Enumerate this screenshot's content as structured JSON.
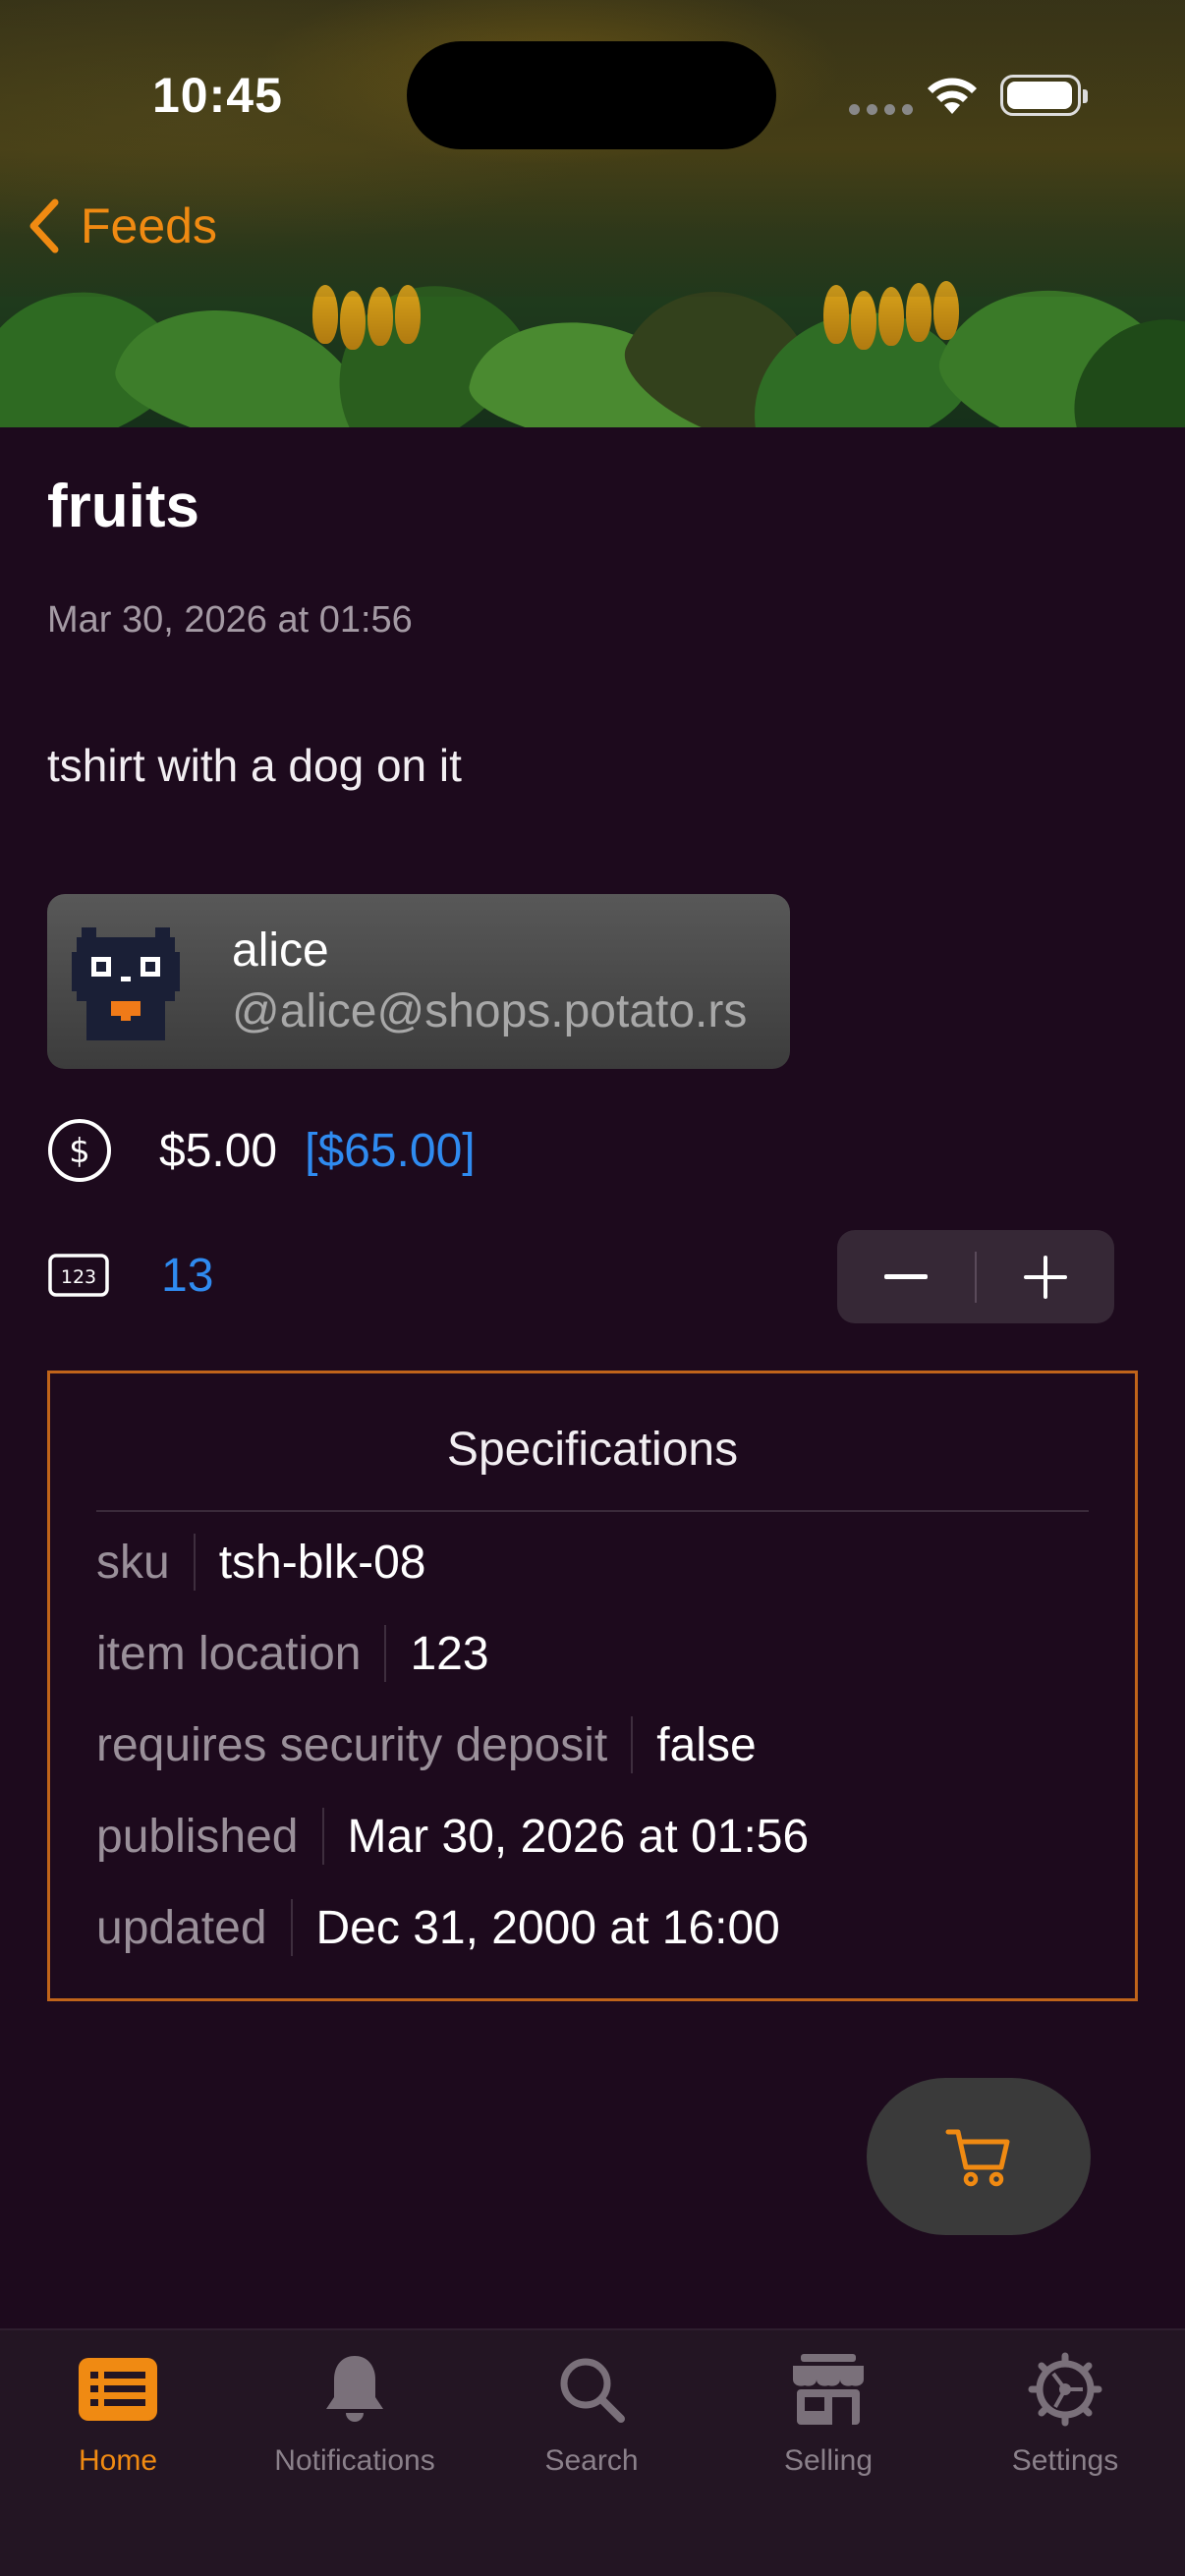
{
  "status_bar": {
    "time": "10:45"
  },
  "nav": {
    "back_label": "Feeds"
  },
  "listing": {
    "title": "fruits",
    "date": "Mar 30, 2026 at 01:56",
    "description": "tshirt with a dog on it",
    "seller": {
      "name": "alice",
      "handle": "@alice@shops.potato.rs"
    },
    "price": "$5.00",
    "price_total": "[$65.00]",
    "quantity": "13"
  },
  "specifications": {
    "title": "Specifications",
    "rows": [
      {
        "key": "sku",
        "value": "tsh-blk-08"
      },
      {
        "key": "item location",
        "value": "123"
      },
      {
        "key": "requires security deposit",
        "value": "false"
      },
      {
        "key": "published",
        "value": "Mar 30, 2026 at 01:56"
      },
      {
        "key": "updated",
        "value": "Dec 31, 2000 at 16:00"
      }
    ]
  },
  "tabbar": {
    "tabs": [
      {
        "label": "Home",
        "icon": "list-icon",
        "active": true
      },
      {
        "label": "Notifications",
        "icon": "bell-icon",
        "active": false
      },
      {
        "label": "Search",
        "icon": "magnifier-icon",
        "active": false
      },
      {
        "label": "Selling",
        "icon": "storefront-icon",
        "active": false
      },
      {
        "label": "Settings",
        "icon": "gear-icon",
        "active": false
      }
    ]
  },
  "colors": {
    "accent": "#f08a12",
    "link": "#2f8bf0",
    "background": "#1d0a1d",
    "spec_border": "#c0641a"
  }
}
